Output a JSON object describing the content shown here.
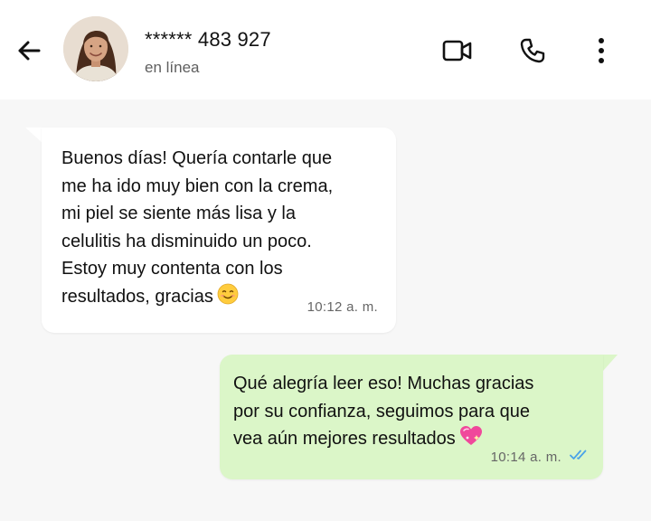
{
  "header": {
    "contact_name": "****** 483 927",
    "status": "en línea",
    "icons": [
      "back-arrow-icon",
      "video-call-icon",
      "phone-icon",
      "more-options-icon"
    ]
  },
  "messages": [
    {
      "direction": "incoming",
      "text": "Buenos días! Quería contarle que\nme ha ido muy bien con la crema,\nmi piel se siente más lisa y la\ncelulitis ha disminuido un poco.\nEstoy muy contenta con los\nresultados, gracias",
      "emoji": "smiling-face-icon",
      "time": "10:12 a. m."
    },
    {
      "direction": "outgoing",
      "text": "Qué alegría leer eso! Muchas gracias\npor su confianza, seguimos para que\nvea aún mejores resultados",
      "emoji": "sparkling-heart-icon",
      "time": "10:14 a. m.",
      "status_icon": "double-check-read-icon"
    }
  ],
  "colors": {
    "incoming_bubble": "#ffffff",
    "outgoing_bubble": "#dbf6c8",
    "read_ticks": "#4aa3e8",
    "background": "#f7f7f7"
  }
}
